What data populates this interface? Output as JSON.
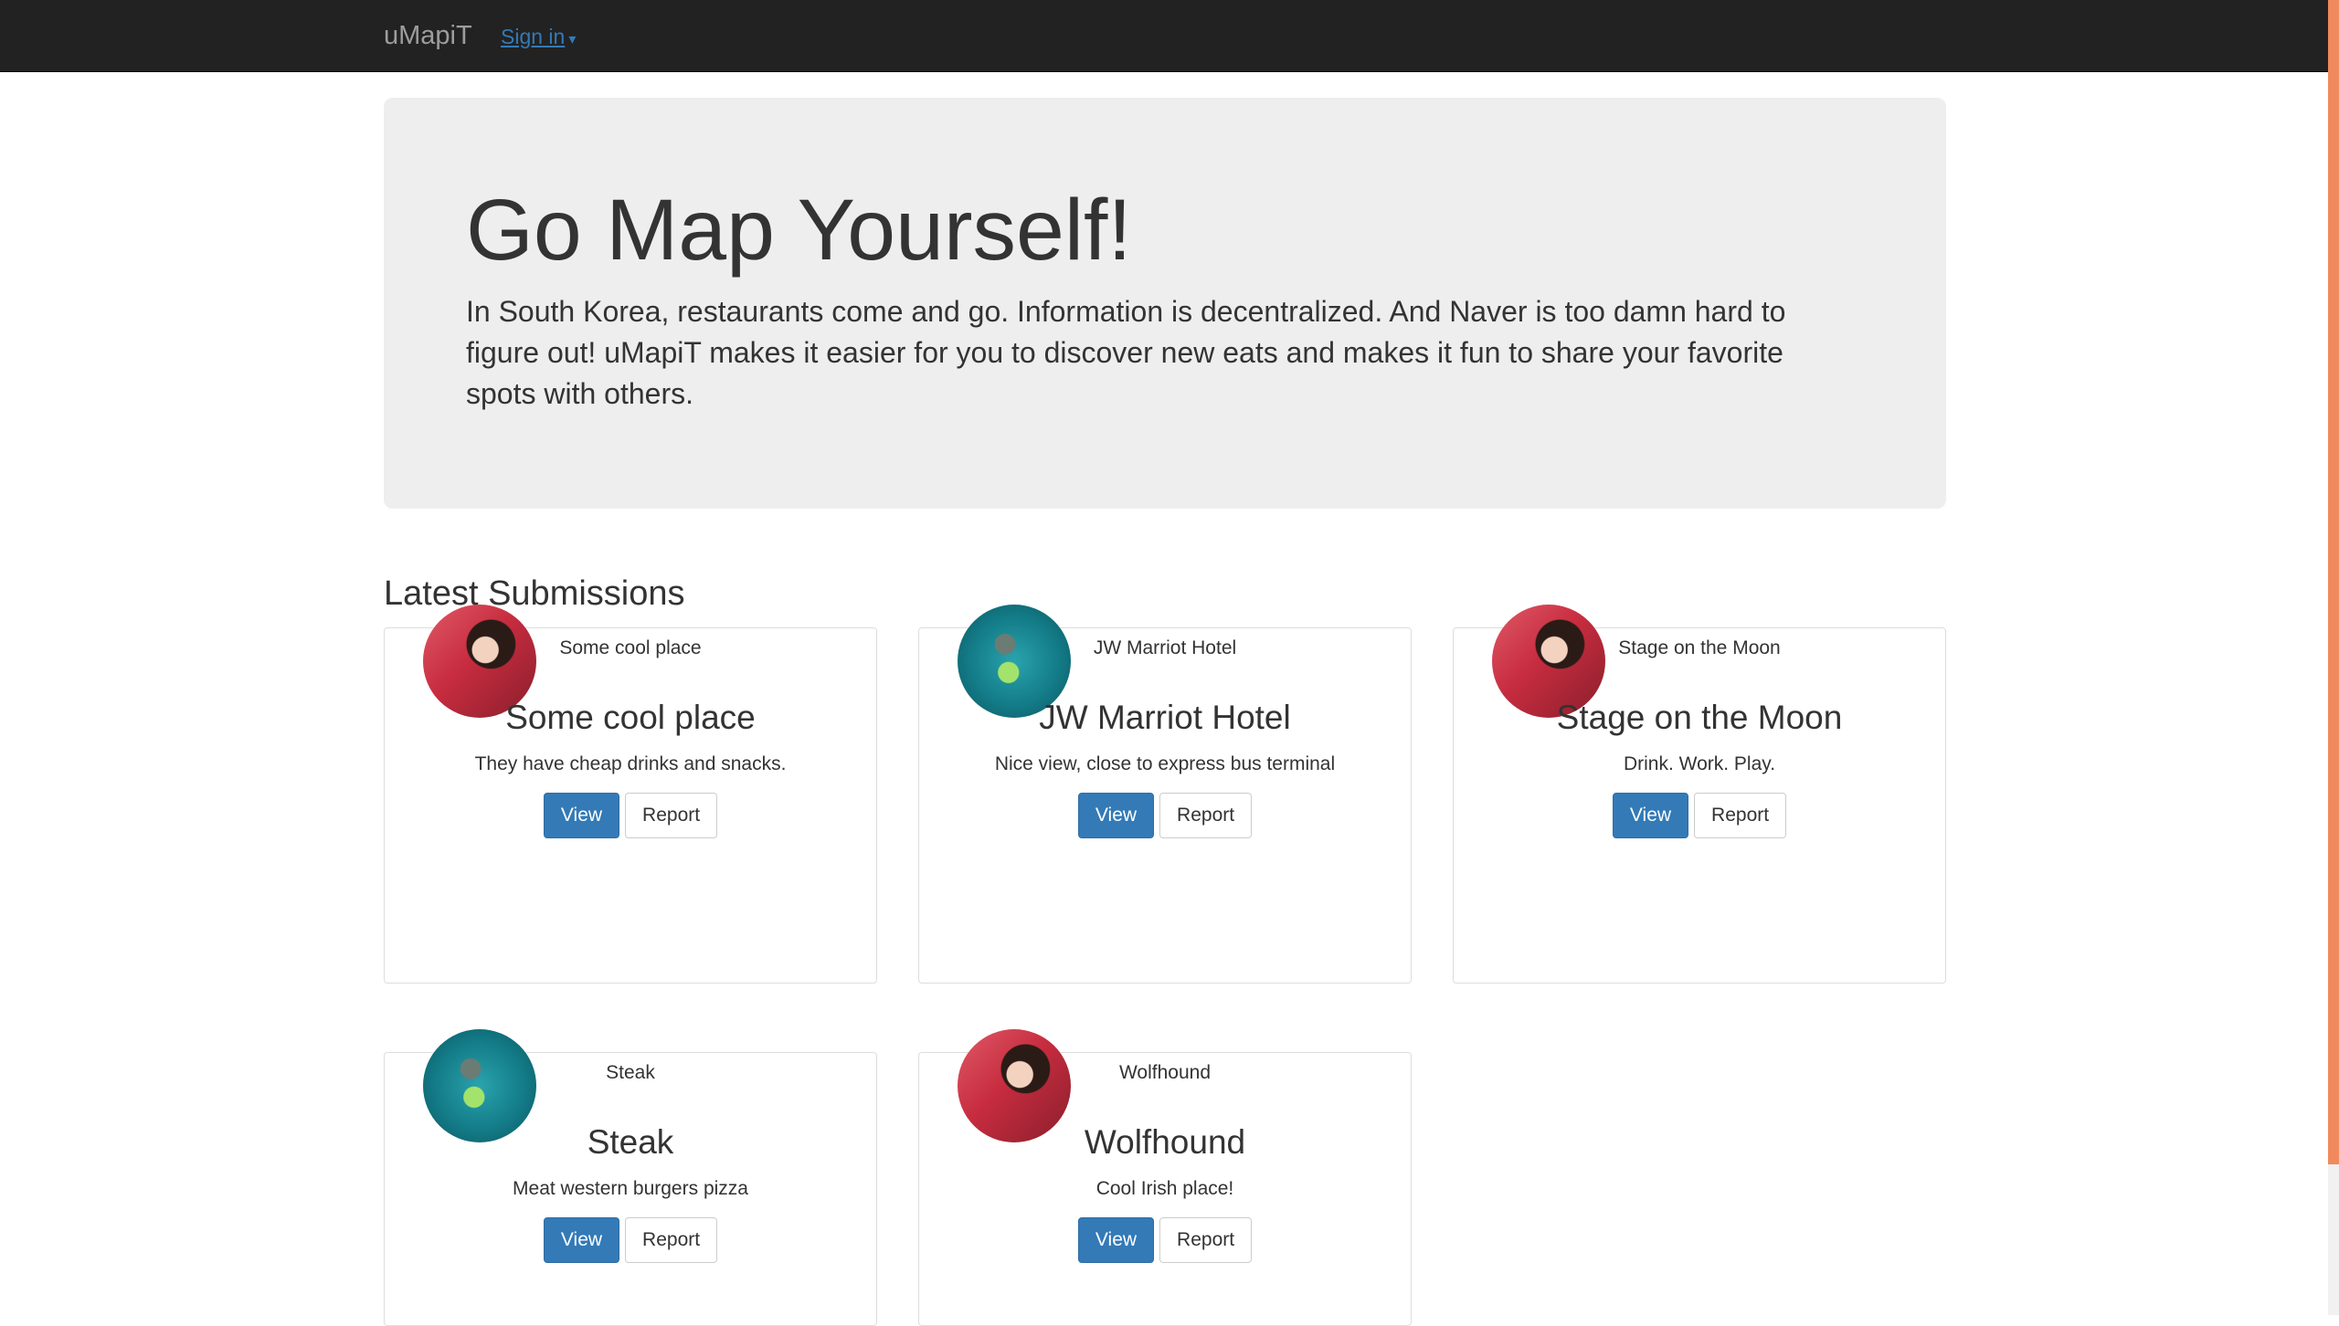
{
  "navbar": {
    "brand": "uMapiT",
    "signin": "Sign in",
    "signin_caret": "▾"
  },
  "jumbotron": {
    "title": "Go Map Yourself!",
    "description": "In South Korea, restaurants come and go. Information is decentralized. And Naver is too damn hard to figure out! uMapiT makes it easier for you to discover new eats and makes it fun to share your favorite spots with others."
  },
  "latest": {
    "heading": "Latest Submissions",
    "items": [
      {
        "subtitle": "Some cool place",
        "title": "Some cool place",
        "text": "They have cheap drinks and snacks.",
        "view": "View",
        "report": "Report",
        "avatar": "red"
      },
      {
        "subtitle": "JW Marriot Hotel",
        "title": "JW Marriot Hotel",
        "text": "Nice view, close to express bus terminal",
        "view": "View",
        "report": "Report",
        "avatar": "teal"
      },
      {
        "subtitle": "Stage on the Moon",
        "title": "Stage on the Moon",
        "text": "Drink. Work. Play.",
        "view": "View",
        "report": "Report",
        "avatar": "red"
      },
      {
        "subtitle": "Steak",
        "title": "Steak",
        "text": "Meat western burgers pizza",
        "view": "View",
        "report": "Report",
        "avatar": "teal"
      },
      {
        "subtitle": "Wolfhound",
        "title": "Wolfhound",
        "text": "Cool Irish place!",
        "view": "View",
        "report": "Report",
        "avatar": "red"
      }
    ]
  },
  "colors": {
    "navbar_bg": "#222222",
    "primary": "#337ab7",
    "jumbotron_bg": "#eeeeee",
    "scrollbar_thumb": "#f08a5d"
  }
}
